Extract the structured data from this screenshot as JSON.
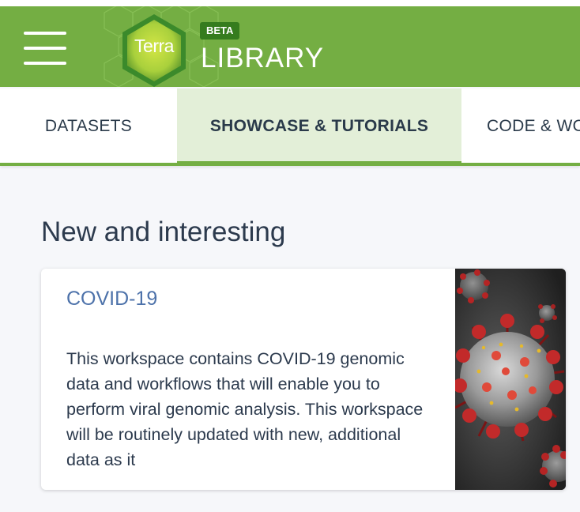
{
  "header": {
    "menu_icon": "hamburger-menu-icon",
    "logo_text": "Terra",
    "badge": "BETA",
    "title": "LIBRARY",
    "colors": {
      "primary": "#74ae43",
      "badge": "#357c1e"
    }
  },
  "tabs": [
    {
      "label": "DATASETS",
      "active": false
    },
    {
      "label": "SHOWCASE & TUTORIALS",
      "active": true
    },
    {
      "label": "CODE & WORKFLOWS",
      "active": false
    }
  ],
  "section": {
    "title": "New and interesting"
  },
  "card": {
    "title": "COVID-19",
    "description": "This workspace contains COVID-19 genomic data and workflows that will enable you to perform viral genomic analysis. This workspace will be routinely updated with new, additional data as it",
    "image": "coronavirus-illustration"
  }
}
